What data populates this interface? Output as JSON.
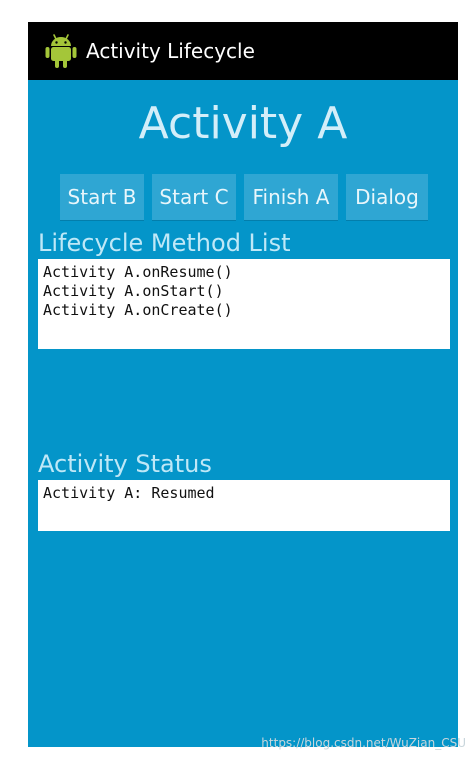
{
  "titlebar": {
    "app_title": "Activity Lifecycle",
    "icon": "android-robot-icon"
  },
  "main": {
    "heading": "Activity A",
    "buttons": [
      {
        "label": "Start B"
      },
      {
        "label": "Start C"
      },
      {
        "label": "Finish A"
      },
      {
        "label": "Dialog"
      }
    ],
    "method_list_label": "Lifecycle Method List",
    "method_list": [
      "Activity A.onResume()",
      "Activity A.onStart()",
      "Activity A.onCreate()"
    ],
    "status_label": "Activity Status",
    "status_value": "Activity A: Resumed"
  },
  "watermark": "https://blog.csdn.net/WuZian_CSU",
  "colors": {
    "background": "#0495c9",
    "titlebar": "#000000",
    "button": "#2fa6d3",
    "android_green": "#a4c639"
  }
}
